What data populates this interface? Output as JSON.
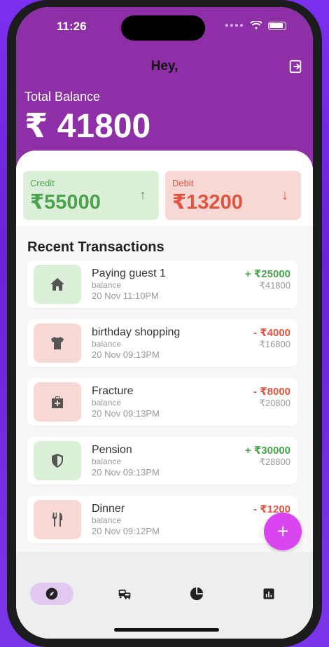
{
  "status_bar": {
    "time": "11:26"
  },
  "header": {
    "greeting": "Hey,"
  },
  "balance": {
    "label": "Total Balance",
    "value": "₹ 41800"
  },
  "summary": {
    "credit": {
      "label": "Credit",
      "amount": "₹55000"
    },
    "debit": {
      "label": "Debit",
      "amount": "₹13200"
    }
  },
  "transactions_title": "Recent Transactions",
  "transactions": [
    {
      "title": "Paying guest 1",
      "sub": "balance",
      "date": "20 Nov 11:10PM",
      "amount": "+ ₹25000",
      "balance": "₹41800",
      "type": "credit",
      "icon": "home-icon"
    },
    {
      "title": "birthday shopping",
      "sub": "balance",
      "date": "20 Nov 09:13PM",
      "amount": "- ₹4000",
      "balance": "₹16800",
      "type": "debit",
      "icon": "shirt-icon"
    },
    {
      "title": "Fracture",
      "sub": "balance",
      "date": "20 Nov 09:13PM",
      "amount": "- ₹8000",
      "balance": "₹20800",
      "type": "debit",
      "icon": "medical-kit-icon"
    },
    {
      "title": "Pension",
      "sub": "balance",
      "date": "20 Nov 09:13PM",
      "amount": "+ ₹30000",
      "balance": "₹28800",
      "type": "credit",
      "icon": "shield-icon"
    },
    {
      "title": "Dinner",
      "sub": "balance",
      "date": "20 Nov 09:12PM",
      "amount": "- ₹1200",
      "balance": "",
      "type": "debit",
      "icon": "restaurant-icon"
    }
  ],
  "fab": {
    "label": "+"
  },
  "nav": {
    "items": [
      "compass-icon",
      "vehicle-icon",
      "pie-chart-icon",
      "bar-chart-icon"
    ]
  },
  "colors": {
    "brand": "#8e2fa8",
    "credit": "#4aa34d",
    "debit": "#e05540",
    "fab": "#d946ef"
  }
}
